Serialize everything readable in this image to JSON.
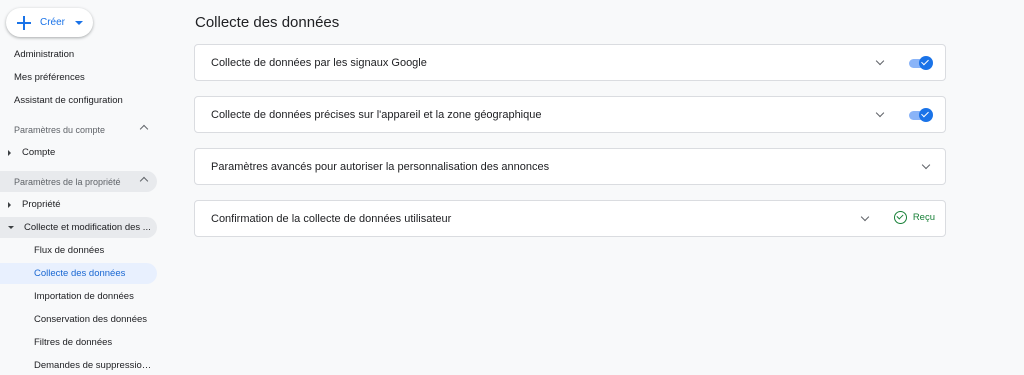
{
  "sidebar": {
    "create_label": "Créer",
    "links": [
      "Administration",
      "Mes préférences",
      "Assistant de configuration"
    ],
    "account_section": {
      "label": "Paramètres du compte",
      "items": [
        "Compte"
      ]
    },
    "property_section": {
      "label": "Paramètres de la propriété",
      "items": [
        "Propriété",
        "Collecte et modification des ..."
      ],
      "subitems": [
        "Flux de données",
        "Collecte des données",
        "Importation de données",
        "Conservation des données",
        "Filtres de données",
        "Demandes de suppression ..."
      ],
      "active_subitem": "Collecte des données"
    }
  },
  "main": {
    "title": "Collecte des données",
    "cards": [
      {
        "title": "Collecte de données par les signaux Google",
        "toggle_on": true
      },
      {
        "title": "Collecte de données précises sur l'appareil et la zone géographique",
        "toggle_on": true
      },
      {
        "title": "Paramètres avancés pour autoriser la personnalisation des annonces"
      },
      {
        "title": "Confirmation de la collecte de données utilisateur",
        "status": "Reçu"
      }
    ]
  },
  "colors": {
    "accent": "#1a73e8",
    "active_bg": "#e8f0fe",
    "success": "#188038"
  },
  "icons": [
    "plus-icon",
    "caret-down-icon",
    "chevron-up-icon",
    "triangle-right-icon",
    "triangle-down-icon",
    "chevron-down-icon",
    "check-circle-icon",
    "toggle-switch"
  ]
}
